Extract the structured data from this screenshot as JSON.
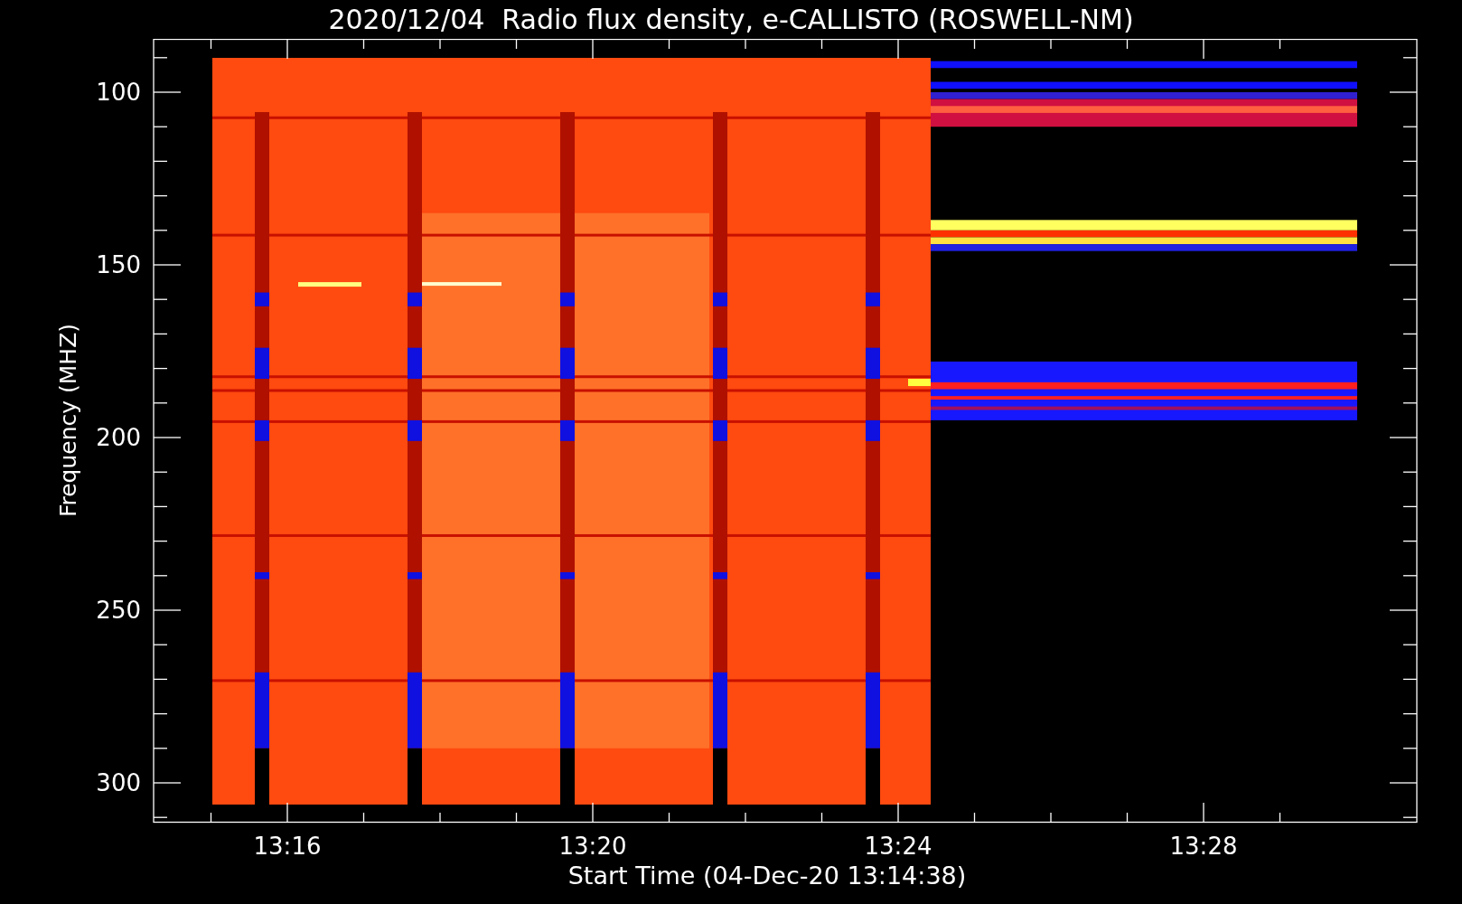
{
  "title": "2020/12/04  Radio flux density, e-CALLISTO (ROSWELL-NM)",
  "y_axis": {
    "label": "Frequency (MHZ)",
    "ticks": [
      "100",
      "150",
      "200",
      "250",
      "300"
    ]
  },
  "x_axis": {
    "label": "Start Time (04-Dec-20 13:14:38)",
    "ticks": [
      "13:16",
      "13:20",
      "13:24",
      "13:28"
    ]
  }
}
